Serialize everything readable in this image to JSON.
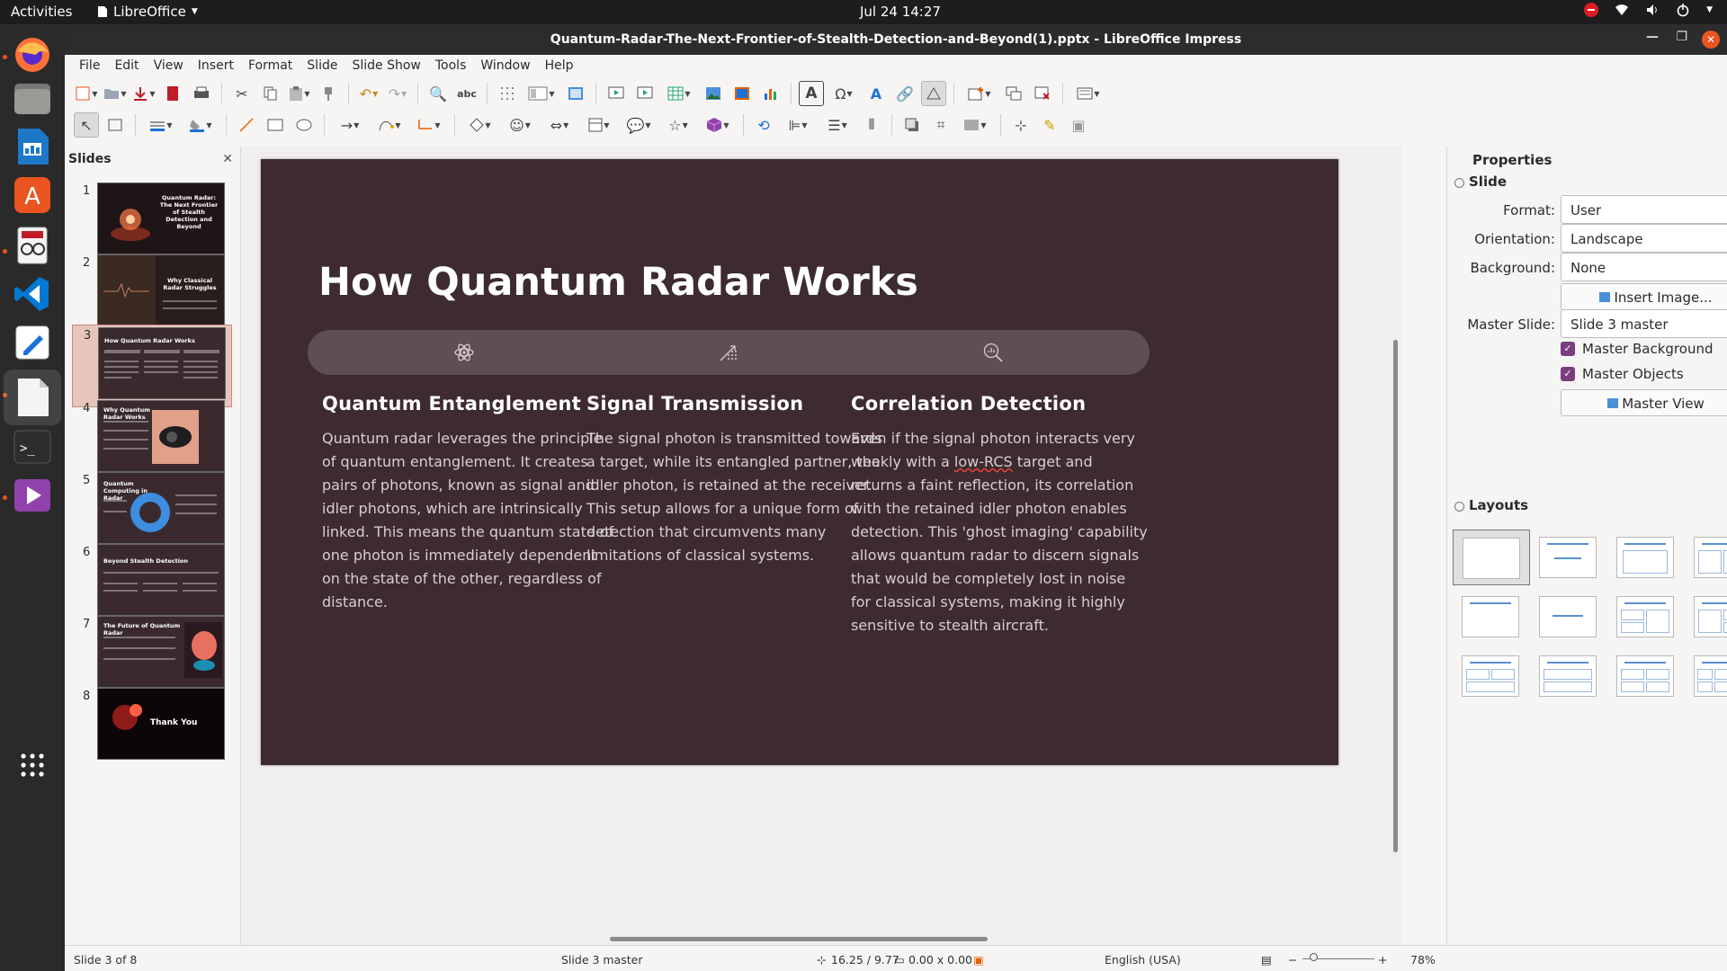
{
  "topbar": {
    "activities": "Activities",
    "app_name": "LibreOffice",
    "clock": "Jul 24  14:27"
  },
  "window": {
    "title": "Quantum-Radar-The-Next-Frontier-of-Stealth-Detection-and-Beyond(1).pptx - LibreOffice Impress"
  },
  "menu": [
    "File",
    "Edit",
    "View",
    "Insert",
    "Format",
    "Slide",
    "Slide Show",
    "Tools",
    "Window",
    "Help"
  ],
  "slides_panel": {
    "title": "Slides",
    "slides": [
      {
        "num": "1",
        "caption": "Quantum Radar: The Next Frontier of Stealth Detection and Beyond"
      },
      {
        "num": "2",
        "caption": "Why Classical Radar Struggles"
      },
      {
        "num": "3",
        "caption": "How Quantum Radar Works"
      },
      {
        "num": "4",
        "caption": "Why Quantum Radar Works"
      },
      {
        "num": "5",
        "caption": "Quantum Computing in Radar"
      },
      {
        "num": "6",
        "caption": "Beyond Stealth Detection"
      },
      {
        "num": "7",
        "caption": "The Future of Quantum Radar"
      },
      {
        "num": "8",
        "caption": "Thank You"
      }
    ]
  },
  "slide": {
    "title": "How Quantum Radar Works",
    "columns": [
      {
        "icon": "atom-icon",
        "title": "Quantum Entanglement",
        "body": "Quantum radar leverages the principle of quantum entanglement. It creates pairs of photons, known as signal and idler photons, which are intrinsically linked. This means the quantum state of one photon is immediately dependent on the state of the other, regardless of distance."
      },
      {
        "icon": "signal-transmission-icon",
        "title": "Signal Transmission",
        "body": "The signal photon is transmitted towards a target, while its entangled partner, the idler photon, is retained at the receiver. This setup allows for a unique form of detection that circumvents many limitations of classical systems."
      },
      {
        "icon": "search-chart-icon",
        "title": "Correlation Detection",
        "body_pre": "Even if the signal photon interacts very weakly with a ",
        "body_flag": "low-RCS",
        "body_post": " target and returns a faint reflection, its correlation with the retained idler photon enables detection. This 'ghost imaging' capability allows quantum radar to discern signals that would be completely lost in noise for classical systems, making it highly sensitive to stealth aircraft."
      }
    ]
  },
  "properties": {
    "title": "Properties",
    "section_slide": "Slide",
    "format_label": "Format:",
    "format_value": "User",
    "orientation_label": "Orientation:",
    "orientation_value": "Landscape",
    "background_label": "Background:",
    "background_value": "None",
    "insert_image": "Insert Image...",
    "master_slide_label": "Master Slide:",
    "master_slide_value": "Slide 3 master",
    "master_background": "Master Background",
    "master_objects": "Master Objects",
    "master_view": "Master View",
    "section_layouts": "Layouts"
  },
  "status": {
    "slide_of": "Slide 3 of 8",
    "master": "Slide 3 master",
    "position": "16.25 / 9.77",
    "size": "0.00 x 0.00",
    "language": "English (USA)",
    "zoom": "78%"
  },
  "colors": {
    "slide_bg": "#3d2b30",
    "pill_bg": "#5e4f52",
    "accent": "#e95420",
    "checkbox": "#7a3e7e"
  }
}
